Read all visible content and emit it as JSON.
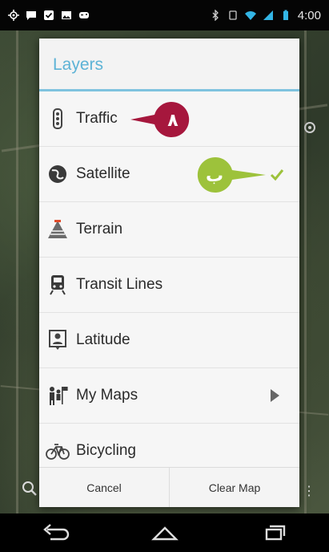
{
  "status_bar": {
    "time": "4:00",
    "left_icons": [
      "location-icon",
      "chat-icon",
      "check-box-icon",
      "image-icon",
      "gamepad-icon"
    ],
    "right_icons": [
      "bluetooth-icon",
      "rotate-icon",
      "wifi-icon",
      "signal-icon",
      "battery-icon"
    ]
  },
  "dialog": {
    "title": "Layers",
    "items": [
      {
        "label": "Traffic",
        "icon": "traffic-light-icon"
      },
      {
        "label": "Satellite",
        "icon": "globe-icon",
        "checked": true
      },
      {
        "label": "Terrain",
        "icon": "terrain-icon"
      },
      {
        "label": "Transit Lines",
        "icon": "train-icon"
      },
      {
        "label": "Latitude",
        "icon": "person-badge-icon"
      },
      {
        "label": "My Maps",
        "icon": "people-flag-icon",
        "submenu": true
      },
      {
        "label": "Bicycling",
        "icon": "bicycle-icon"
      }
    ],
    "buttons": {
      "cancel": "Cancel",
      "clear_map": "Clear Map"
    }
  },
  "annotations": [
    {
      "text": "٨",
      "color": "#a6173d"
    },
    {
      "text": "ب",
      "color": "#9dc23b"
    }
  ],
  "colors": {
    "title": "#5db3d6",
    "check": "#9dc23b"
  },
  "nav_bar": {
    "icons": [
      "back-icon",
      "home-icon",
      "recents-icon"
    ]
  }
}
